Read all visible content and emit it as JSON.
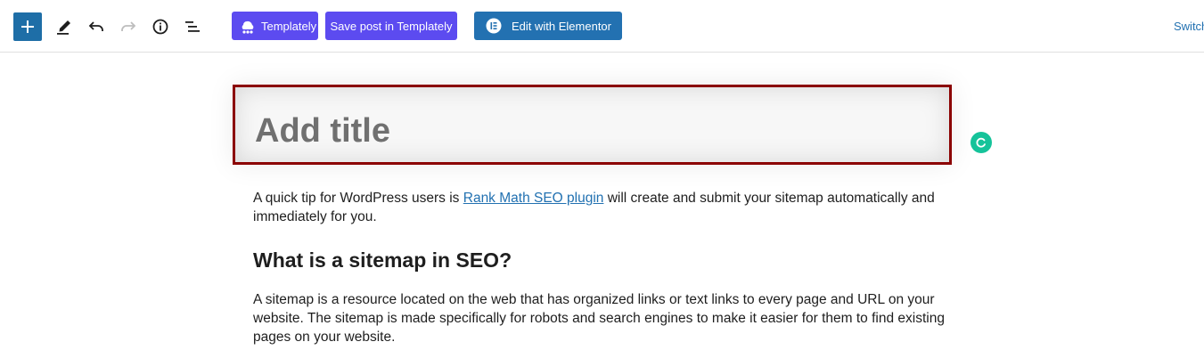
{
  "toolbar": {
    "add_icon": "plus-icon",
    "tools": [
      {
        "name": "edit-tool",
        "icon": "pencil-icon"
      },
      {
        "name": "undo",
        "icon": "undo-icon"
      },
      {
        "name": "redo",
        "icon": "redo-icon"
      },
      {
        "name": "details",
        "icon": "info-icon"
      },
      {
        "name": "list-view",
        "icon": "list-view-icon"
      }
    ],
    "templately_label": "Templately",
    "save_templately_label": "Save post in Templately",
    "elementor_label": "Edit with Elementor",
    "switch_label": "Switch",
    "colors": {
      "add_button": "#1e6ea7",
      "templately": "#5c4bf0",
      "elementor": "#2371b1",
      "link": "#2271b1"
    }
  },
  "editor": {
    "title_placeholder": "Add title",
    "title_border_color": "#8b0000",
    "paragraph1": {
      "before": "A quick tip for WordPress users is ",
      "link": "Rank Math SEO plugin",
      "after": " will create and submit your sitemap automatically and immediately for you."
    },
    "heading": "What is a sitemap in SEO?",
    "paragraph2": "A sitemap is a resource located on the web that has organized links or text links to every page and URL on your website. The sitemap is made specifically for robots and search engines to make it easier for them to find existing pages on your website."
  },
  "grammarly": {
    "icon": "grammarly-icon",
    "color": "#15c39a"
  }
}
